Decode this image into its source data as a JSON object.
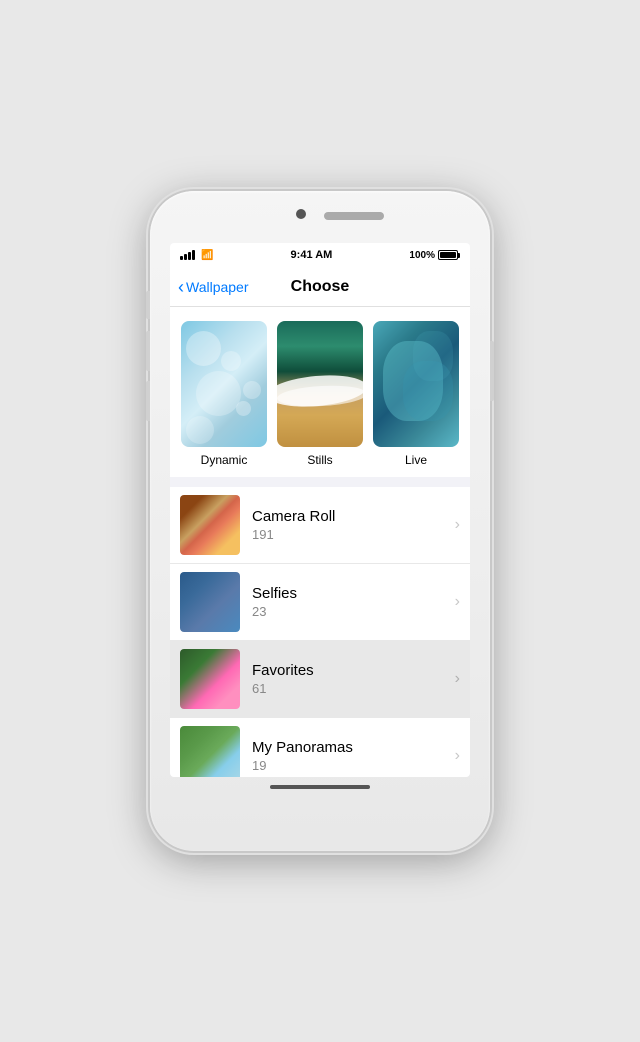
{
  "phone": {
    "status_bar": {
      "time": "9:41 AM",
      "battery_percent": "100%"
    },
    "nav": {
      "back_label": "Wallpaper",
      "title": "Choose"
    },
    "wallpaper_types": [
      {
        "id": "dynamic",
        "label": "Dynamic"
      },
      {
        "id": "stills",
        "label": "Stills"
      },
      {
        "id": "live",
        "label": "Live"
      }
    ],
    "photo_albums": [
      {
        "id": "camera-roll",
        "label": "Camera Roll",
        "count": "191",
        "highlighted": false
      },
      {
        "id": "selfies",
        "label": "Selfies",
        "count": "23",
        "highlighted": false
      },
      {
        "id": "favorites",
        "label": "Favorites",
        "count": "61",
        "highlighted": true
      },
      {
        "id": "my-panoramas",
        "label": "My Panoramas",
        "count": "19",
        "highlighted": false
      }
    ]
  }
}
